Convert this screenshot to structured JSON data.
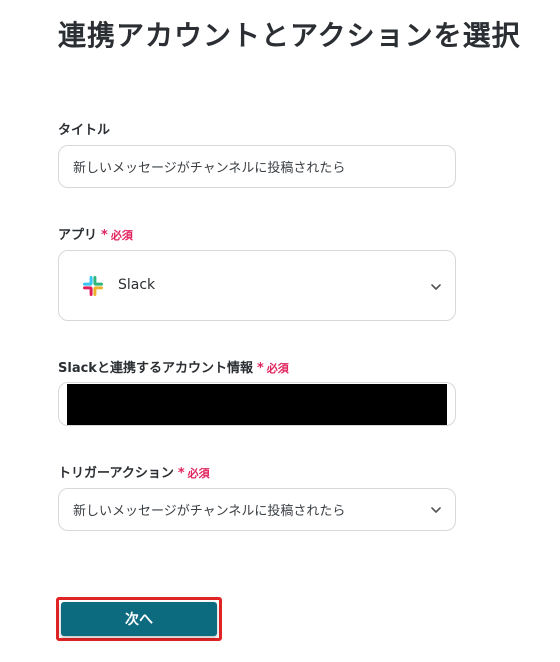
{
  "page": {
    "title": "連携アカウントとアクションを選択"
  },
  "form": {
    "title_field": {
      "label": "タイトル",
      "value": "新しいメッセージがチャンネルに投稿されたら"
    },
    "app_field": {
      "label": "アプリ",
      "required_mark": "*",
      "required_text": "必須",
      "selected_app": "Slack",
      "app_icon": "slack-logo-icon"
    },
    "account_field": {
      "label": "Slackと連携するアカウント情報",
      "required_mark": "*",
      "required_text": "必須"
    },
    "trigger_field": {
      "label": "トリガーアクション",
      "required_mark": "*",
      "required_text": "必須",
      "selected_value": "新しいメッセージがチャンネルに投稿されたら"
    }
  },
  "actions": {
    "next_label": "次へ"
  },
  "colors": {
    "primary_button": "#0d6b7f",
    "highlight_outline": "#e02424",
    "required": "#e0245e"
  }
}
